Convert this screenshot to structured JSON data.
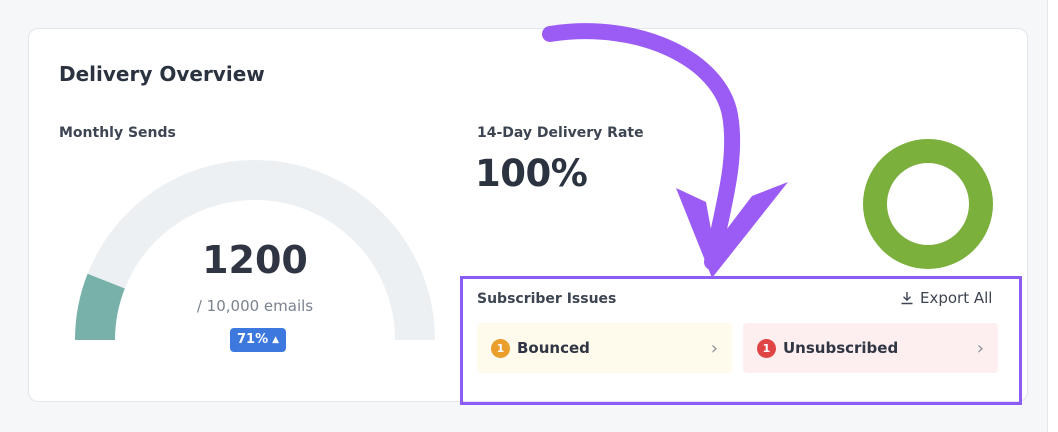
{
  "card": {
    "title": "Delivery Overview"
  },
  "monthly_sends": {
    "label": "Monthly Sends",
    "value": "1200",
    "subtext": "/ 10,000 emails",
    "badge": "71%",
    "gauge_fill_fraction": 0.12,
    "gauge_fill_color": "#78b1a9",
    "gauge_track_color": "#edf0f3"
  },
  "delivery_rate": {
    "label": "14-Day Delivery Rate",
    "value": "100%",
    "ring_color": "#7bb03c"
  },
  "subscriber_issues": {
    "title": "Subscriber Issues",
    "export_label": "Export All",
    "items": [
      {
        "count": "1",
        "label": "Bounced",
        "dot_color": "#ea9e2b",
        "bg": "#fefaec"
      },
      {
        "count": "1",
        "label": "Unsubscribed",
        "dot_color": "#e04545",
        "bg": "#fdeff0"
      }
    ]
  },
  "annotation": {
    "color": "#9b5cf5"
  }
}
